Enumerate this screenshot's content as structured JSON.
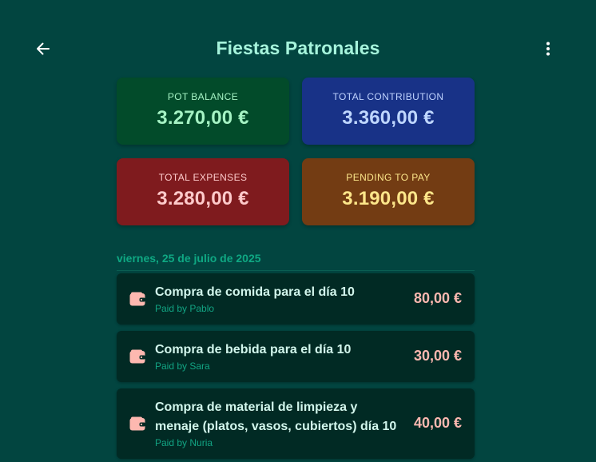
{
  "header": {
    "title": "Fiestas Patronales",
    "back_icon": "arrow-left-icon",
    "menu_icon": "more-vert-icon"
  },
  "summary": {
    "pot_balance": {
      "label": "POT BALANCE",
      "value": "3.270,00 €"
    },
    "total_contribution": {
      "label": "TOTAL CONTRIBUTION",
      "value": "3.360,00 €"
    },
    "total_expenses": {
      "label": "TOTAL EXPENSES",
      "value": "3.280,00 €"
    },
    "pending_to_pay": {
      "label": "PENDING TO PAY",
      "value": "3.190,00 €"
    }
  },
  "expenses_section": {
    "date": "viernes, 25 de julio de 2025",
    "items": [
      {
        "description": "Compra de comida para el día 10",
        "payer": "Paid by Pablo",
        "amount": "80,00 €",
        "icon": "wallet-icon"
      },
      {
        "description": "Compra de bebida para el día 10",
        "payer": "Paid by Sara",
        "amount": "30,00 €",
        "icon": "wallet-icon"
      },
      {
        "description": "Compra de material de limpieza y menaje (platos, vasos, cubiertos) día 10",
        "payer": "Paid by Nuria",
        "amount": "40,00 €",
        "icon": "wallet-icon"
      }
    ]
  },
  "colors": {
    "background": "#024540",
    "title": "#a6f4dc",
    "pot_card": "#024b2a",
    "contribution_card": "#183287",
    "expenses_card": "#7f1b1e",
    "pending_card": "#733c13",
    "expense_item_bg": "#012a24",
    "amount": "#fdb8b0",
    "accent_green": "#12a483"
  }
}
